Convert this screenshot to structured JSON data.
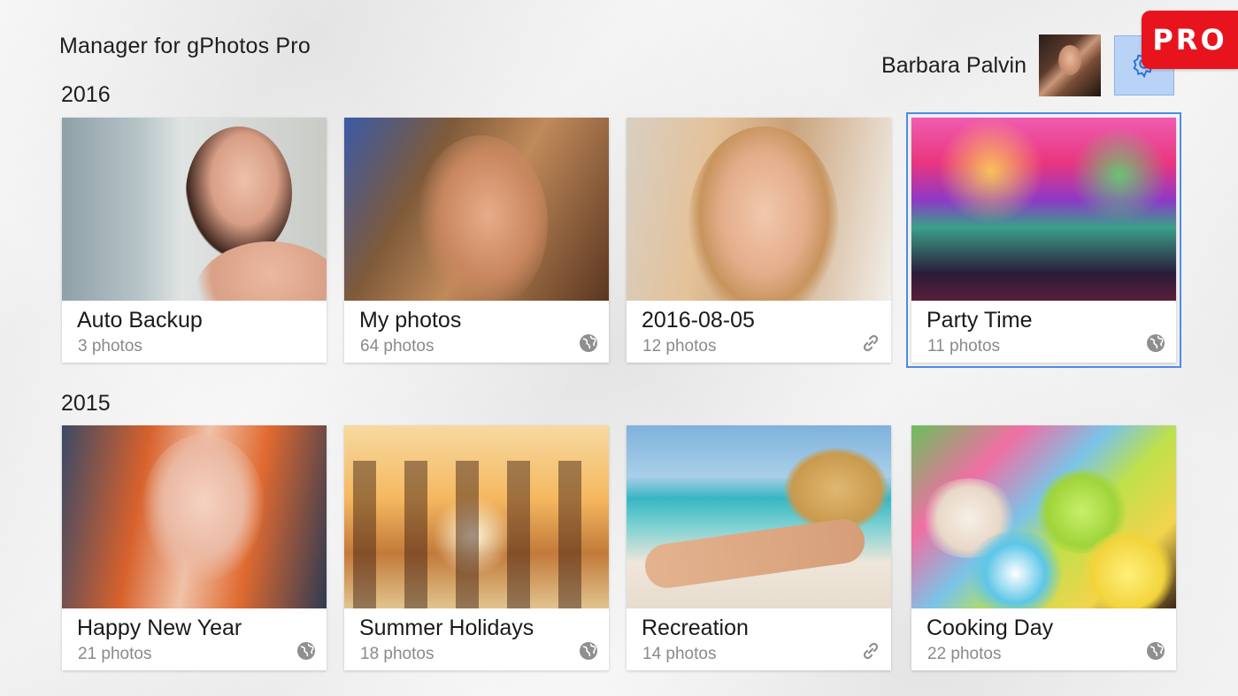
{
  "app": {
    "title": "Manager for gPhotos Pro"
  },
  "user": {
    "name": "Barbara Palvin"
  },
  "badge": {
    "label": "PRO"
  },
  "sections": [
    {
      "year": "2016",
      "albums": [
        {
          "title": "Auto Backup",
          "count": "3 photos",
          "icon": ""
        },
        {
          "title": "My photos",
          "count": "64 photos",
          "icon": "globe-icon"
        },
        {
          "title": "2016-08-05",
          "count": "12 photos",
          "icon": "link-icon"
        },
        {
          "title": "Party Time",
          "count": "11 photos",
          "icon": "globe-icon"
        }
      ]
    },
    {
      "year": "2015",
      "albums": [
        {
          "title": "Happy New Year",
          "count": "21 photos",
          "icon": "globe-icon"
        },
        {
          "title": "Summer Holidays",
          "count": "18 photos",
          "icon": "globe-icon"
        },
        {
          "title": "Recreation",
          "count": "14 photos",
          "icon": "link-icon"
        },
        {
          "title": "Cooking Day",
          "count": "22 photos",
          "icon": "globe-icon"
        }
      ]
    }
  ],
  "colors": {
    "accent": "#4f8ae6",
    "settings_bg": "#b9d3f7",
    "badge_bg": "#e8141d",
    "count_text": "#8a8a8a"
  }
}
